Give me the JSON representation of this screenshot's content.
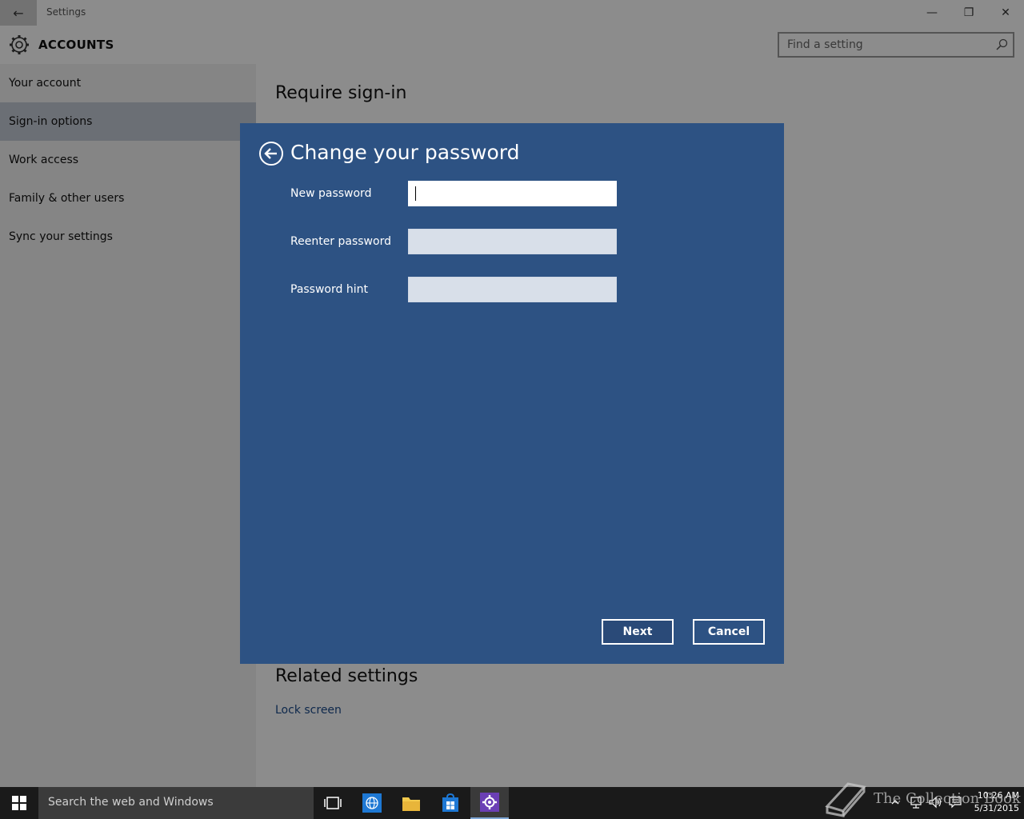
{
  "titlebar": {
    "title": "Settings"
  },
  "header": {
    "title": "ACCOUNTS",
    "search_placeholder": "Find a setting"
  },
  "sidebar": {
    "items": [
      {
        "label": "Your account"
      },
      {
        "label": "Sign-in options"
      },
      {
        "label": "Work access"
      },
      {
        "label": "Family & other users"
      },
      {
        "label": "Sync your settings"
      }
    ],
    "active_index": 1
  },
  "content": {
    "heading": "Require sign-in",
    "related_heading": "Related settings",
    "related_link": "Lock screen"
  },
  "dialog": {
    "title": "Change your password",
    "fields": [
      {
        "label": "New password",
        "value": "",
        "focused": true
      },
      {
        "label": "Reenter password",
        "value": ""
      },
      {
        "label": "Password hint",
        "value": ""
      }
    ],
    "next_label": "Next",
    "cancel_label": "Cancel"
  },
  "taskbar": {
    "search_placeholder": "Search the web and Windows",
    "time": "10:26 AM",
    "date": "5/31/2015"
  },
  "watermark": {
    "text": "The Collection Book"
  },
  "colors": {
    "dialog_bg": "#2d5283",
    "accent": "#7fa7d6",
    "active_nav": "#c4cad6"
  }
}
